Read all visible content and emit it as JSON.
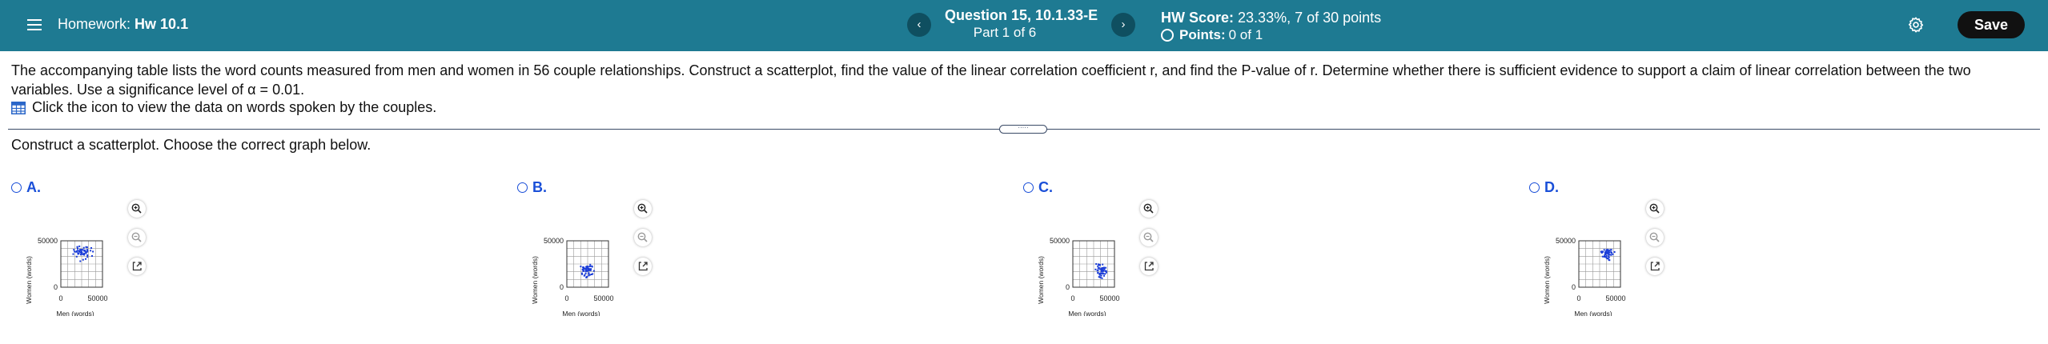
{
  "header": {
    "homework_prefix": "Homework:",
    "homework_name": "Hw 10.1",
    "prev_label": "‹",
    "next_label": "›",
    "question_title": "Question 15, 10.1.33-E",
    "question_part": "Part 1 of 6",
    "score_prefix": "HW Score:",
    "score_value": "23.33%, 7 of 30 points",
    "points_prefix": "Points:",
    "points_value": "0 of 1",
    "save_label": "Save"
  },
  "question": {
    "text": "The accompanying table lists the word counts measured from men and women in 56 couple relationships. Construct a scatterplot, find the value of the linear correlation coefficient r, and find the P-value of r. Determine whether there is sufficient evidence to support a claim of linear correlation between the two variables. Use a significance level of α = 0.01.",
    "data_link": "Click the icon to view the data on words spoken by the couples.",
    "instruction": "Construct a scatterplot. Choose the correct graph below."
  },
  "options": [
    {
      "letter": "A.",
      "cluster": [
        0.5,
        0.75
      ],
      "spread": [
        0.32,
        0.22
      ]
    },
    {
      "letter": "B.",
      "cluster": [
        0.5,
        0.35
      ],
      "spread": [
        0.22,
        0.22
      ]
    },
    {
      "letter": "C.",
      "cluster": [
        0.68,
        0.35
      ],
      "spread": [
        0.22,
        0.22
      ]
    },
    {
      "letter": "D.",
      "cluster": [
        0.68,
        0.72
      ],
      "spread": [
        0.22,
        0.2
      ]
    }
  ],
  "chart_common": {
    "xlabel": "Men (words)",
    "ylabel": "Women (words)",
    "y_tick_top": "50000",
    "y_tick_bottom": "0",
    "x_tick_left": "0",
    "x_tick_right": "50000",
    "point_color": "#1a3cd8"
  }
}
